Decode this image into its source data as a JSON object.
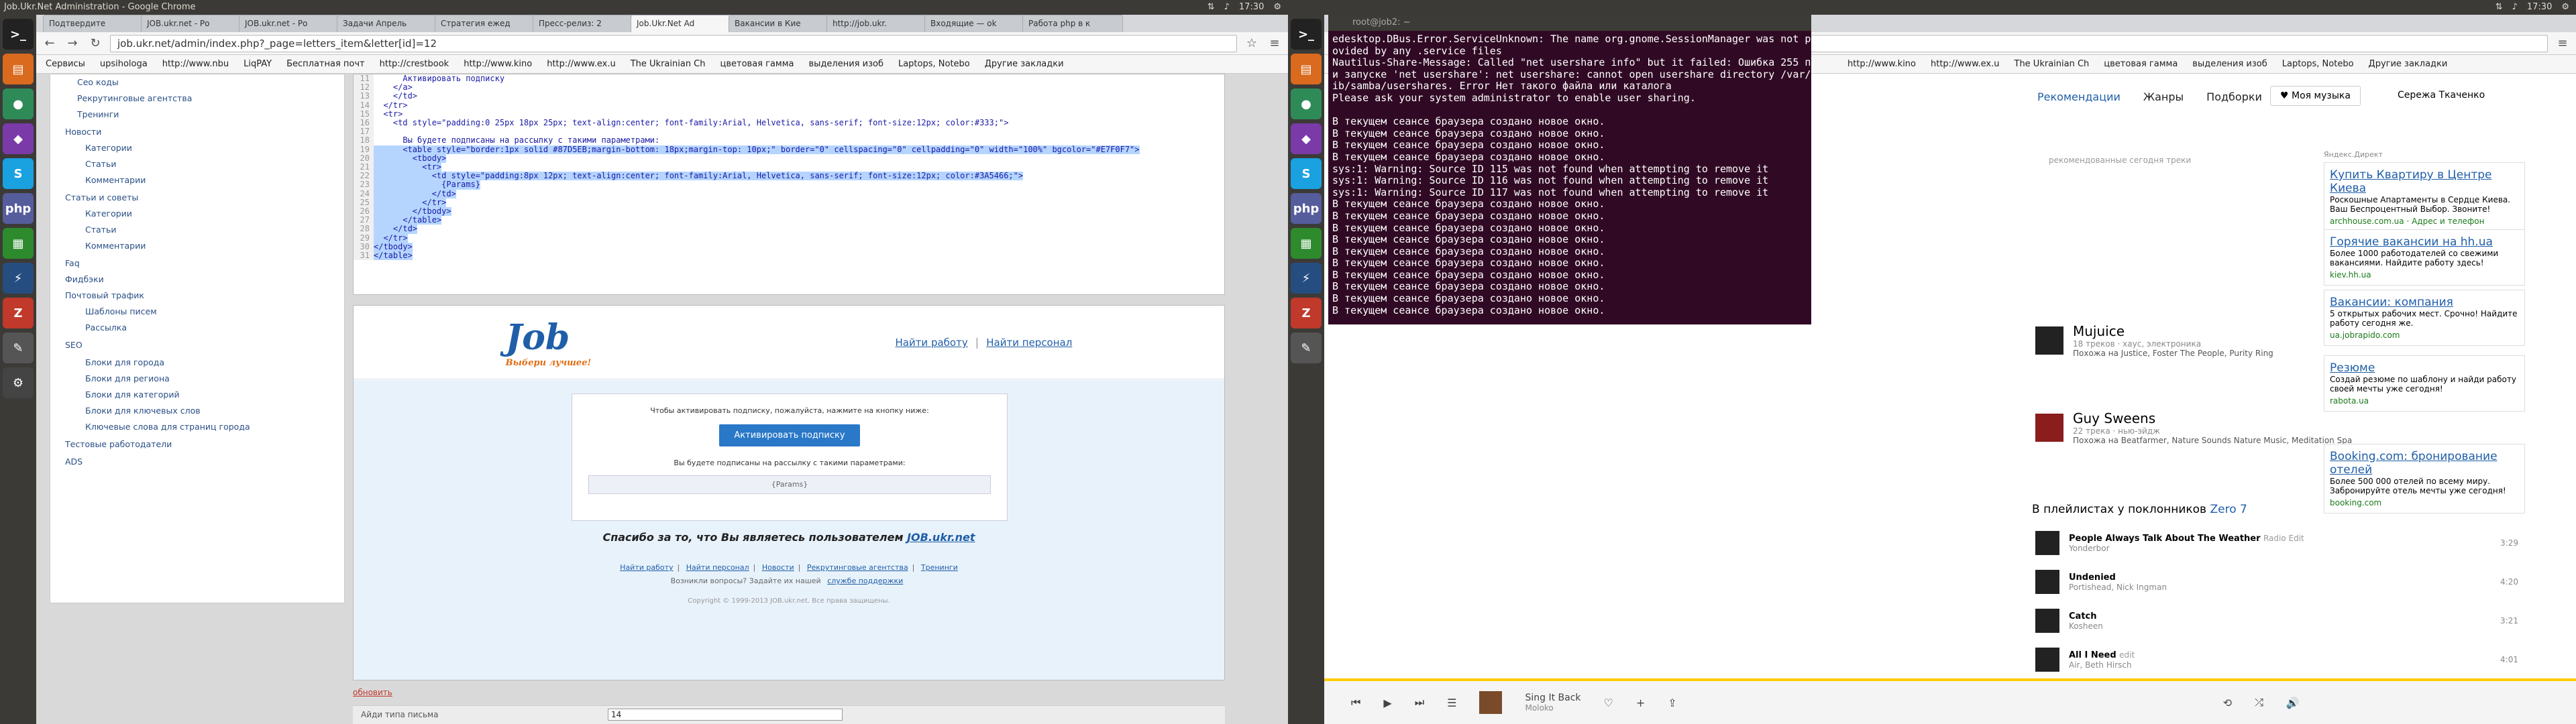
{
  "top_panel_left": {
    "window_title": "Job.Ukr.Net Administration - Google Chrome",
    "time": "17:30"
  },
  "top_panel_right": {
    "time": "17:30"
  },
  "browser_left": {
    "tabs": [
      "Подтвердите",
      "JOB.ukr.net - Ро",
      "JOB.ukr.net - Ро",
      "Задачи Апрель",
      "Стратегия ежед",
      "Пресс-релиз: 2",
      "Job.Ukr.Net Ad",
      "Вакансии в Кие",
      "http://job.ukr.",
      "Входящие — ok",
      "Работа php в к"
    ],
    "url": "job.ukr.net/admin/index.php?_page=letters_item&letter[id]=12",
    "bookmarks": [
      "Сервисы",
      "upsihologa",
      "http://www.nbu",
      "LiqPAY",
      "Бесплатная почт",
      "http://crestbook",
      "http://www.kino",
      "http://www.ex.u",
      "The Ukrainian Ch",
      "цветовая гамма",
      "выделения изоб",
      "Laptops, Notebo",
      "Другие закладки"
    ]
  },
  "sidebar": {
    "items": [
      "Сео коды",
      "Рекрутинговые агентства",
      "Тренинги",
      "Новости",
      "Категории",
      "Статьи",
      "Комментарии",
      "Статьи и советы",
      "Категории",
      "Статьи",
      "Комментарии",
      "Faq",
      "Фидбэки",
      "Почтовый трафик",
      "Шаблоны писем",
      "Рассылка",
      "SEO",
      "Блоки для города",
      "Блоки для региона",
      "Блоки для категорий",
      "Блоки для ключевых слов",
      "Ключевые слова для страниц города",
      "Тестовые работодатели",
      "ADS"
    ]
  },
  "code_lines": [
    {
      "n": "11",
      "t": "      Активировать подписку",
      "hl": false
    },
    {
      "n": "12",
      "t": "    </a>",
      "hl": false
    },
    {
      "n": "13",
      "t": "    </td>",
      "hl": false
    },
    {
      "n": "14",
      "t": "  </tr>",
      "hl": false
    },
    {
      "n": "15",
      "t": "  <tr>",
      "hl": false
    },
    {
      "n": "16",
      "t": "    <td style=\"padding:0 25px 18px 25px; text-align:center; font-family:Arial, Helvetica, sans-serif; font-size:12px; color:#333;\">",
      "hl": false
    },
    {
      "n": "17",
      "t": "",
      "hl": false
    },
    {
      "n": "18",
      "t": "      Вы будете подписаны на рассылку с такими параметрами:",
      "hl": false
    },
    {
      "n": "19",
      "t": "      <table style=\"border:1px solid #87D5EB;margin-bottom: 18px;margin-top: 10px;\" border=\"0\" cellspacing=\"0\" cellpadding=\"0\" width=\"100%\" bgcolor=\"#E7F0F7\">",
      "hl": true
    },
    {
      "n": "20",
      "t": "        <tbody>",
      "hl": true
    },
    {
      "n": "21",
      "t": "          <tr>",
      "hl": true
    },
    {
      "n": "22",
      "t": "            <td style=\"padding:8px 12px; text-align:center; font-family:Arial, Helvetica, sans-serif; font-size:12px; color:#3A5466;\">",
      "hl": true
    },
    {
      "n": "23",
      "t": "              {Params}",
      "hl": true
    },
    {
      "n": "24",
      "t": "            </td>",
      "hl": true
    },
    {
      "n": "25",
      "t": "          </tr>",
      "hl": true
    },
    {
      "n": "26",
      "t": "        </tbody>",
      "hl": true
    },
    {
      "n": "27",
      "t": "      </table>",
      "hl": true
    },
    {
      "n": "28",
      "t": "    </td>",
      "hl": true
    },
    {
      "n": "29",
      "t": "  </tr>",
      "hl": true
    },
    {
      "n": "30",
      "t": "</tbody>",
      "hl": true
    },
    {
      "n": "31",
      "t": "</table>",
      "hl": true
    }
  ],
  "preview": {
    "logo": "Job",
    "logo_tagline": "Выбери лучшее!",
    "find_job": "Найти работу",
    "find_staff": "Найти персонал",
    "activate_prompt": "Чтобы активировать подписку, пожалуйста, нажмите на кнопку ниже:",
    "activate_button": "Активировать подписку",
    "params_prompt": "Вы будете подписаны на рассылку с такими параметрами:",
    "params": "{Params}",
    "thanks": "Спасибо за то, что Вы являетесь пользователем",
    "thanks_link": "JOB.ukr.net",
    "footer_links": [
      "Найти работу",
      "Найти персонал",
      "Новости",
      "Рекрутинговые агентства",
      "Тренинги"
    ],
    "questions": "Возникли вопросы? Задайте их нашей",
    "support": "службе поддержки",
    "copyright": "Copyright © 1999-2013 JOB.ukr.net. Все права защищены."
  },
  "bottom_form": {
    "refresh": "обновить",
    "label": "Айди типа письма",
    "value": "14"
  },
  "terminal": {
    "title": "root@job2: ~",
    "lines": [
      "edesktop.DBus.Error.ServiceUnknown: The name org.gnome.SessionManager was not pr",
      "ovided by any .service files",
      "Nautilus-Share-Message: Called \"net usershare info\" but it failed: Ошибка 255 пр",
      "и запуске 'net usershare': net usershare: cannot open usershare directory /var/l",
      "ib/samba/usershares. Error Нет такого файла или каталога",
      "Please ask your system administrator to enable user sharing.",
      "",
      "В текущем сеансе браузера создано новое окно.",
      "В текущем сеансе браузера создано новое окно.",
      "В текущем сеансе браузера создано новое окно.",
      "В текущем сеансе браузера создано новое окно.",
      "sys:1: Warning: Source ID 115 was not found when attempting to remove it",
      "sys:1: Warning: Source ID 116 was not found when attempting to remove it",
      "sys:1: Warning: Source ID 117 was not found when attempting to remove it",
      "В текущем сеансе браузера создано новое окно.",
      "В текущем сеансе браузера создано новое окно.",
      "В текущем сеансе браузера создано новое окно.",
      "В текущем сеансе браузера создано новое окно.",
      "В текущем сеансе браузера создано новое окно.",
      "В текущем сеансе браузера создано новое окно.",
      "В текущем сеансе браузера создано новое окно.",
      "В текущем сеансе браузера создано новое окно.",
      "В текущем сеансе браузера создано новое окно.",
      "В текущем сеансе браузера создано новое окно."
    ]
  },
  "music": {
    "bookmarks": [
      "http://www.kino",
      "http://www.ex.u",
      "The Ukrainian Ch",
      "цветовая гамма",
      "выделения изоб",
      "Laptops, Notebo",
      "Другие закладки"
    ],
    "nav": [
      "Рекомендации",
      "Жанры",
      "Подборки"
    ],
    "my_music": "Моя музыка",
    "user": "Сережа Ткаченко",
    "rec_hint": "рекомендованные сегодня треки",
    "artists": [
      {
        "name": "Mujuice",
        "meta": "18 треков · хаус, электроника",
        "similar": "Похожа на Justice, Foster The People, Purity Ring"
      },
      {
        "name": "Guy Sweens",
        "meta": "22 трека · нью-эйдж",
        "similar": "Похожа на Beatfarmer, Nature Sounds Nature Music, Meditation Spa"
      }
    ],
    "playlists_title": "В плейлистах у поклонников",
    "playlists_artist": "Zero 7",
    "tracks": [
      {
        "title": "People Always Talk About The Weather",
        "tag": "Radio Edit",
        "artist": "Yonderbor",
        "dur": "3:29"
      },
      {
        "title": "Undenied",
        "tag": "",
        "artist": "Portishead, Nick Ingman",
        "dur": "4:20"
      },
      {
        "title": "Catch",
        "tag": "",
        "artist": "Kosheen",
        "dur": "3:21"
      },
      {
        "title": "All I Need",
        "tag": "edit",
        "artist": "Air, Beth Hirsch",
        "dur": "4:01"
      }
    ],
    "ads_label": "Яндекс.Директ",
    "ads": [
      {
        "h": "Купить Квартиру в Центре Киева",
        "t": "Роскошные Апартаменты в Сердце Киева. Ваш Беспроцентный Выбор. Звоните!",
        "u": "archhouse.com.ua · Адрес и телефон"
      },
      {
        "h": "Горячие вакансии на hh.ua",
        "t": "Более 1000 работодателей со свежими вакансиями. Найдите работу здесь!",
        "u": "kiev.hh.ua"
      },
      {
        "h": "Вакансии: компания",
        "t": "5 открытых рабочих мест. Срочно! Найдите работу сегодня же.",
        "u": "ua.jobrapido.com"
      },
      {
        "h": "Резюме",
        "t": "Создай резюме по шаблону и найди работу своей мечты уже сегодня!",
        "u": "rabota.ua"
      },
      {
        "h": "Booking.com: бронирование отелей",
        "t": "Более 500 000 отелей по всему миру. Забронируйте отель мечты уже сегодня!",
        "u": "booking.com"
      }
    ],
    "now_playing": {
      "title": "Sing It Back",
      "artist": "Moloko"
    }
  }
}
